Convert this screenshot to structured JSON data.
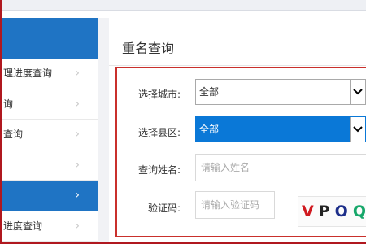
{
  "sidebar": {
    "items": [
      {
        "label": "理进度查询",
        "active": false
      },
      {
        "label": "询",
        "active": false
      },
      {
        "label": "查询",
        "active": false
      },
      {
        "label": "",
        "active": false
      },
      {
        "label": "",
        "active": true
      },
      {
        "label": "进度查询",
        "active": false
      }
    ]
  },
  "main": {
    "title": "重名查询",
    "form": {
      "city_label": "选择城市:",
      "city_value": "全部",
      "district_label": "选择县区:",
      "district_value": "全部",
      "name_label": "查询姓名:",
      "name_placeholder": "请输入姓名",
      "captcha_label": "验证码:",
      "captcha_placeholder": "请输入验证码",
      "captcha_chars": [
        {
          "char": "V",
          "color": "#d0191f"
        },
        {
          "char": "P",
          "color": "#222222"
        },
        {
          "char": "O",
          "color": "#1d2f8a"
        },
        {
          "char": "Q",
          "color": "#17a76a"
        }
      ]
    }
  },
  "colors": {
    "sidebar_accent": "#1f74c4",
    "highlight_frame": "#c9302c",
    "selected_option": "#0a78d7"
  }
}
